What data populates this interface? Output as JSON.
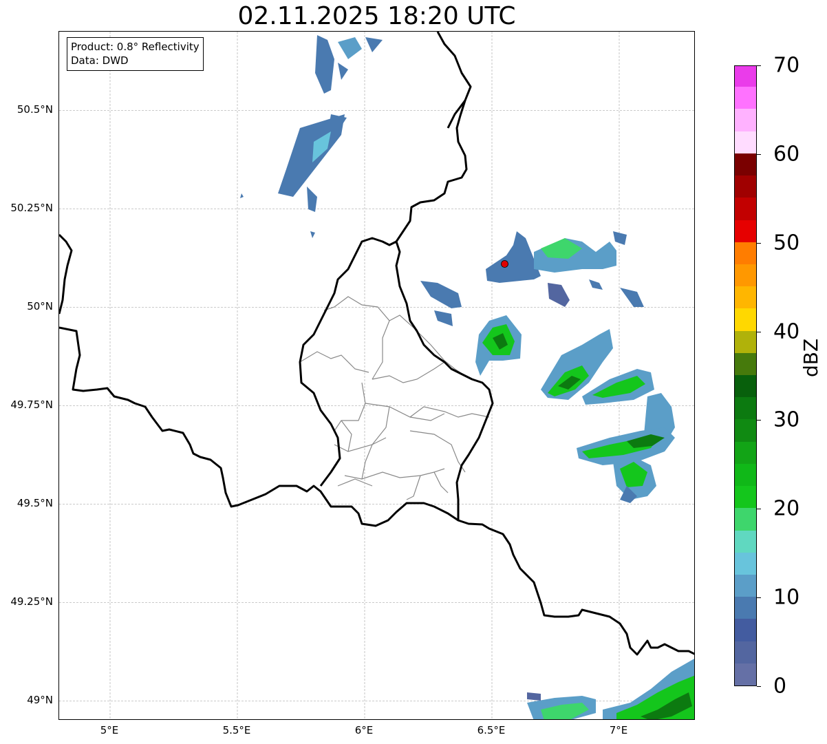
{
  "title": "02.11.2025 18:20 UTC",
  "info_box": {
    "product": "Product: 0.8° Reflectivity",
    "source": "Data: DWD"
  },
  "map": {
    "extent": {
      "lon_min": 4.8,
      "lon_max": 7.3,
      "lat_min": 48.95,
      "lat_max": 50.7
    },
    "lat_ticks": [
      {
        "value": 50.5,
        "label": "50.5°N"
      },
      {
        "value": 50.25,
        "label": "50.25°N"
      },
      {
        "value": 50.0,
        "label": "50°N"
      },
      {
        "value": 49.75,
        "label": "49.75°N"
      },
      {
        "value": 49.5,
        "label": "49.5°N"
      },
      {
        "value": 49.25,
        "label": "49.25°N"
      },
      {
        "value": 49.0,
        "label": "49°N"
      }
    ],
    "lon_ticks": [
      {
        "value": 5.0,
        "label": "5°E"
      },
      {
        "value": 5.5,
        "label": "5.5°E"
      },
      {
        "value": 6.0,
        "label": "6°E"
      },
      {
        "value": 6.5,
        "label": "6.5°E"
      },
      {
        "value": 7.0,
        "label": "7°E"
      }
    ],
    "radar_site": {
      "lon": 6.55,
      "lat": 50.11,
      "color": "#e00000"
    }
  },
  "colorbar": {
    "unit": "dBZ",
    "min": 0,
    "max": 70,
    "step": 2.5,
    "tick_labels": [
      "0",
      "10",
      "20",
      "30",
      "40",
      "50",
      "60",
      "70"
    ],
    "colors": [
      "#6570a6",
      "#5366a0",
      "#435ca0",
      "#4a7ab0",
      "#5b9ec8",
      "#68c4dc",
      "#60d8c0",
      "#3ed66c",
      "#14c61c",
      "#10b818",
      "#12a416",
      "#108a12",
      "#0c7a10",
      "#08600c",
      "#467a0c",
      "#b0b20a",
      "#ffd800",
      "#ffb600",
      "#ff9800",
      "#ff7d00",
      "#e60000",
      "#c20000",
      "#a00000",
      "#7a0000",
      "#ffdcff",
      "#ffb2ff",
      "#ff72ff",
      "#ea3cea"
    ]
  }
}
